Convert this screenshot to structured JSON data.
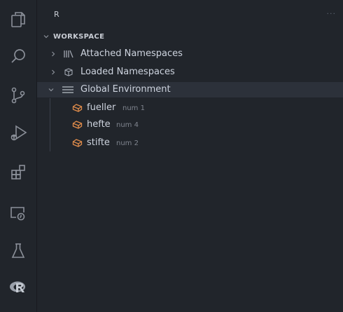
{
  "colors": {
    "background": "#21252b",
    "selected_row": "#2c313a",
    "accent_orange": "#e08c4b",
    "icon_gray": "#7f848e"
  },
  "activity_bar": {
    "items": [
      {
        "name": "explorer",
        "icon": "copy-files-icon"
      },
      {
        "name": "search",
        "icon": "search-icon"
      },
      {
        "name": "source-control",
        "icon": "source-control-icon"
      },
      {
        "name": "run-debug",
        "icon": "run-debug-icon"
      },
      {
        "name": "extensions",
        "icon": "extensions-icon"
      },
      {
        "name": "remote-explorer",
        "icon": "remote-explorer-icon"
      },
      {
        "name": "testing",
        "icon": "flask-icon"
      },
      {
        "name": "r",
        "icon": "r-logo-icon"
      }
    ]
  },
  "sidebar": {
    "title": "R",
    "more": "···",
    "section": {
      "title": "WORKSPACE"
    },
    "tree": [
      {
        "label": "Attached Namespaces",
        "icon": "library-icon",
        "expanded": false
      },
      {
        "label": "Loaded Namespaces",
        "icon": "package-icon",
        "expanded": false
      },
      {
        "label": "Global Environment",
        "icon": "list-icon",
        "expanded": true,
        "selected": true
      },
      {
        "label": "fueller",
        "desc": "num 1",
        "icon": "variable-icon"
      },
      {
        "label": "hefte",
        "desc": "num 4",
        "icon": "variable-icon"
      },
      {
        "label": "stifte",
        "desc": "num 2",
        "icon": "variable-icon"
      }
    ]
  }
}
